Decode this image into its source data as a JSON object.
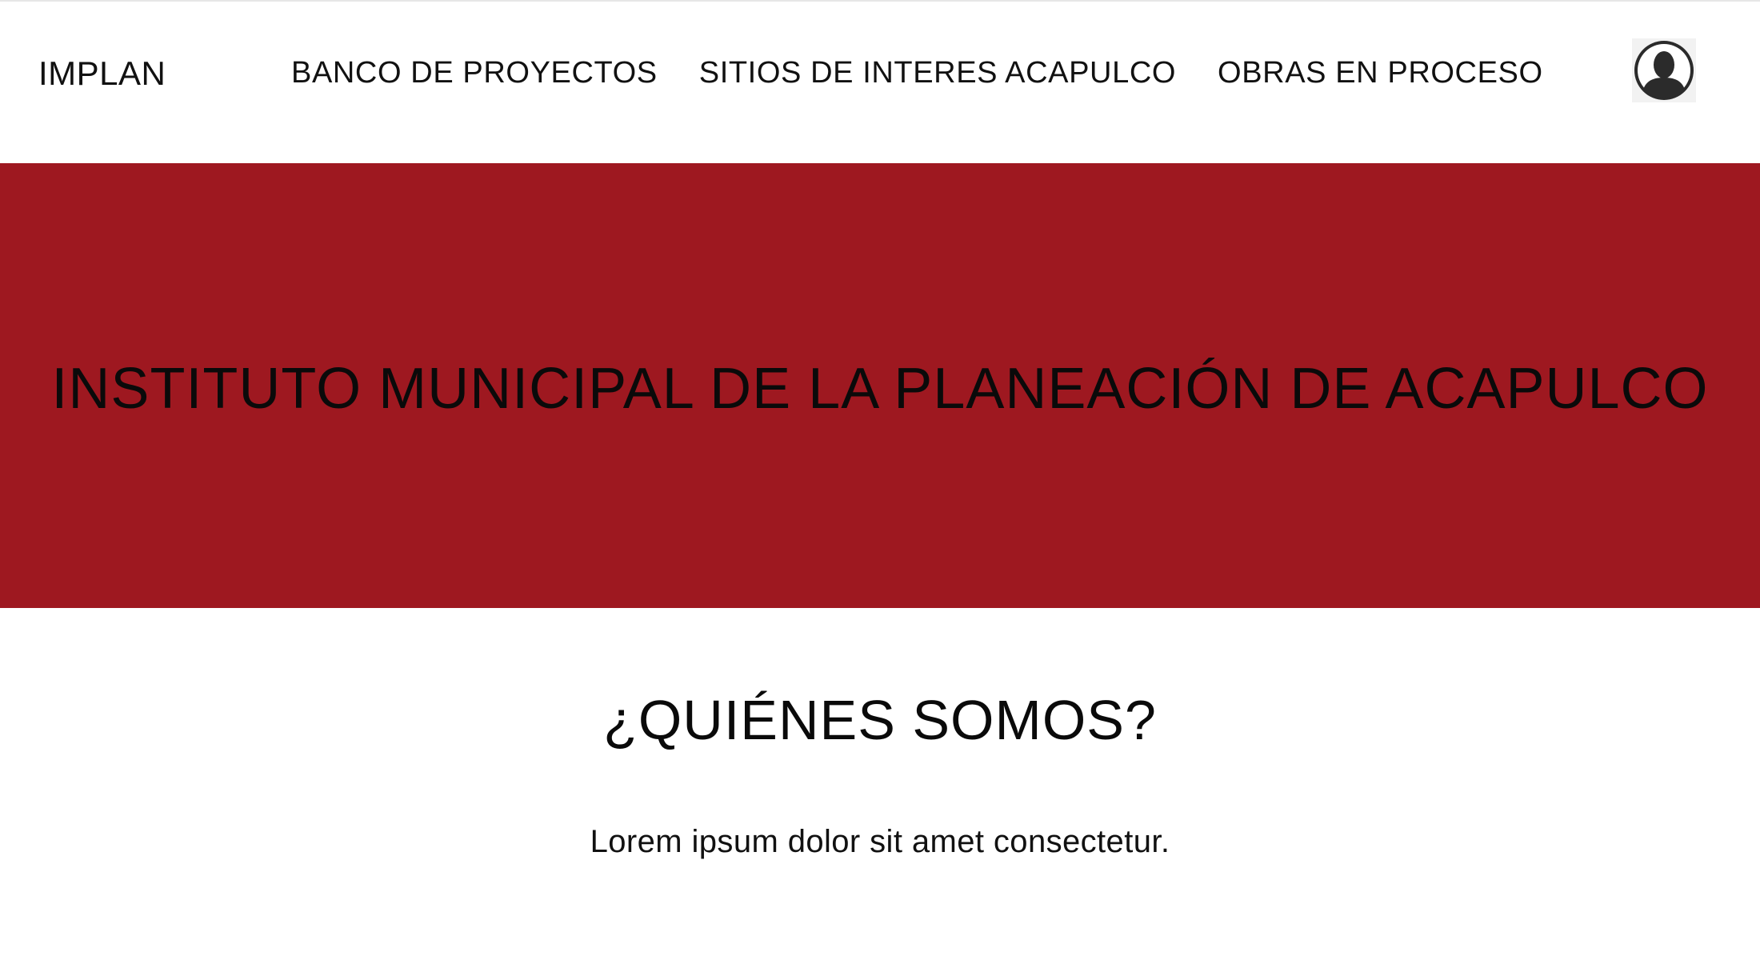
{
  "navbar": {
    "brand": "IMPLAN",
    "links": [
      {
        "label": "BANCO DE PROYECTOS"
      },
      {
        "label": "SITIOS DE INTERES ACAPULCO"
      },
      {
        "label": "OBRAS EN PROCESO"
      }
    ],
    "avatar_icon": "user-avatar-icon"
  },
  "hero": {
    "title": "INSTITUTO MUNICIPAL DE LA PLANEACIÓN DE ACAPULCO",
    "background_color": "#9e1820"
  },
  "about": {
    "title": "¿QUIÉNES SOMOS?",
    "text": "Lorem ipsum dolor sit amet consectetur."
  }
}
